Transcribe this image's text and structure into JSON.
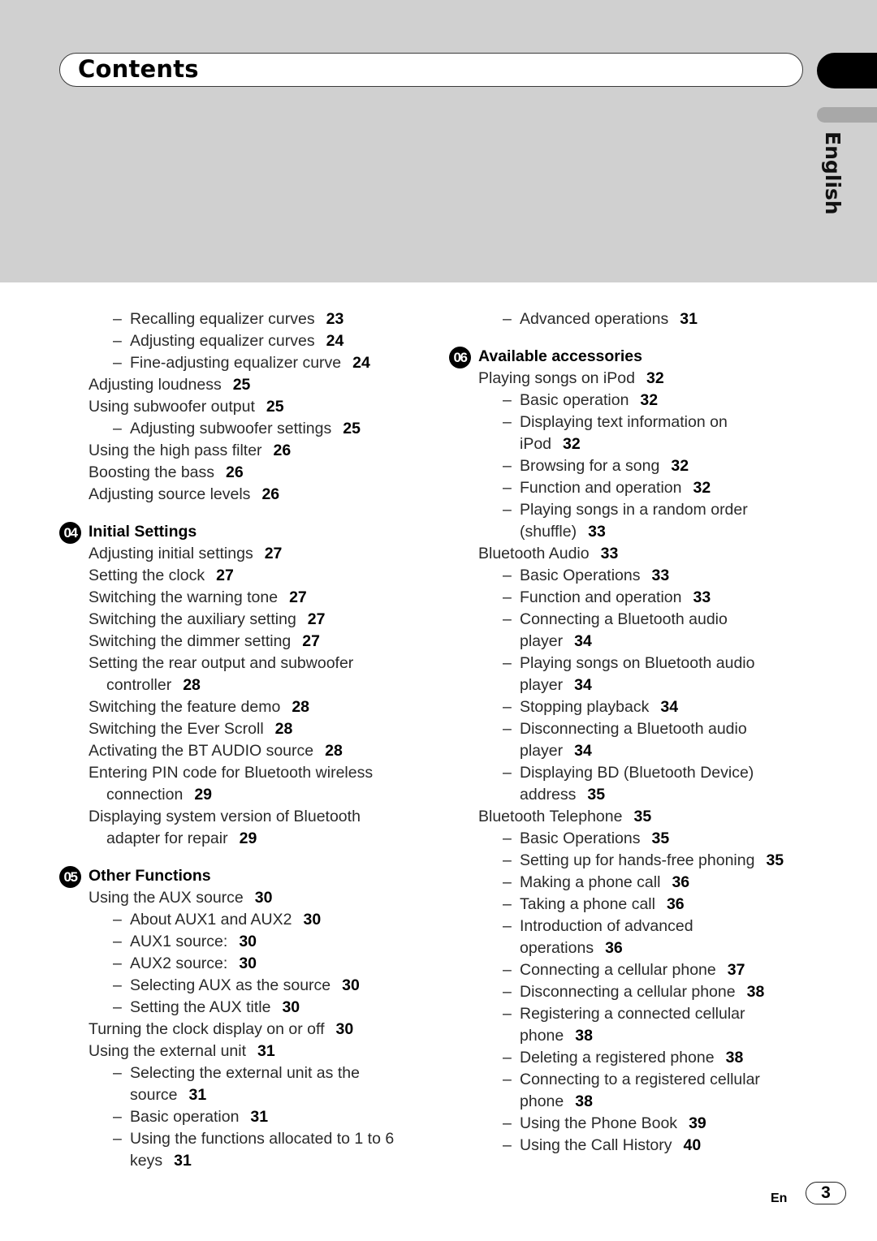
{
  "header": {
    "title": "Contents",
    "language_tab": "English"
  },
  "left_column": {
    "pre_entries": [
      {
        "level": 2,
        "text": "Recalling equalizer curves",
        "page": "23"
      },
      {
        "level": 2,
        "text": "Adjusting equalizer curves",
        "page": "24"
      },
      {
        "level": 2,
        "text": "Fine-adjusting equalizer curve",
        "page": "24"
      },
      {
        "level": 1,
        "text": "Adjusting loudness",
        "page": "25"
      },
      {
        "level": 1,
        "text": "Using subwoofer output",
        "page": "25"
      },
      {
        "level": 2,
        "text": "Adjusting subwoofer settings",
        "page": "25"
      },
      {
        "level": 1,
        "text": "Using the high pass filter",
        "page": "26"
      },
      {
        "level": 1,
        "text": "Boosting the bass",
        "page": "26"
      },
      {
        "level": 1,
        "text": "Adjusting source levels",
        "page": "26"
      }
    ],
    "sections": [
      {
        "number": "04",
        "title": "Initial Settings",
        "entries": [
          {
            "level": 1,
            "text": "Adjusting initial settings",
            "page": "27"
          },
          {
            "level": 1,
            "text": "Setting the clock",
            "page": "27"
          },
          {
            "level": 1,
            "text": "Switching the warning tone",
            "page": "27"
          },
          {
            "level": 1,
            "text": "Switching the auxiliary setting",
            "page": "27"
          },
          {
            "level": 1,
            "text": "Switching the dimmer setting",
            "page": "27"
          },
          {
            "level": 1,
            "text": "Setting the rear output and subwoofer",
            "cont": "controller",
            "page": "28"
          },
          {
            "level": 1,
            "text": "Switching the feature demo",
            "page": "28"
          },
          {
            "level": 1,
            "text": "Switching the Ever Scroll",
            "page": "28"
          },
          {
            "level": 1,
            "text": "Activating the BT AUDIO source",
            "page": "28"
          },
          {
            "level": 1,
            "text": "Entering PIN code for Bluetooth wireless",
            "cont": "connection",
            "page": "29"
          },
          {
            "level": 1,
            "text": "Displaying system version of Bluetooth",
            "cont": "adapter for repair",
            "page": "29"
          }
        ]
      },
      {
        "number": "05",
        "title": "Other Functions",
        "entries": [
          {
            "level": 1,
            "text": "Using the AUX source",
            "page": "30"
          },
          {
            "level": 2,
            "text": "About AUX1 and AUX2",
            "page": "30"
          },
          {
            "level": 2,
            "text": "AUX1 source:",
            "page": "30"
          },
          {
            "level": 2,
            "text": "AUX2 source:",
            "page": "30"
          },
          {
            "level": 2,
            "text": "Selecting AUX as the source",
            "page": "30"
          },
          {
            "level": 2,
            "text": "Setting the AUX title",
            "page": "30"
          },
          {
            "level": 1,
            "text": "Turning the clock display on or off",
            "page": "30"
          },
          {
            "level": 1,
            "text": "Using the external unit",
            "page": "31"
          },
          {
            "level": 2,
            "text": "Selecting the external unit as the",
            "cont": "source",
            "page": "31"
          },
          {
            "level": 2,
            "text": "Basic operation",
            "page": "31"
          },
          {
            "level": 2,
            "text": "Using the functions allocated to 1 to 6",
            "cont": "keys",
            "page": "31"
          }
        ]
      }
    ]
  },
  "right_column": {
    "pre_entries": [
      {
        "level": 2,
        "text": "Advanced operations",
        "page": "31"
      }
    ],
    "sections": [
      {
        "number": "06",
        "title": "Available accessories",
        "entries": [
          {
            "level": 1,
            "text": "Playing songs on iPod",
            "page": "32"
          },
          {
            "level": 2,
            "text": "Basic operation",
            "page": "32"
          },
          {
            "level": 2,
            "text": "Displaying text information on",
            "cont": "iPod",
            "page": "32"
          },
          {
            "level": 2,
            "text": "Browsing for a song",
            "page": "32"
          },
          {
            "level": 2,
            "text": "Function and operation",
            "page": "32"
          },
          {
            "level": 2,
            "text": "Playing songs in a random order",
            "cont": "(shuffle)",
            "page": "33"
          },
          {
            "level": 1,
            "text": "Bluetooth Audio",
            "page": "33"
          },
          {
            "level": 2,
            "text": "Basic Operations",
            "page": "33"
          },
          {
            "level": 2,
            "text": "Function and operation",
            "page": "33"
          },
          {
            "level": 2,
            "text": "Connecting a Bluetooth audio",
            "cont": "player",
            "page": "34"
          },
          {
            "level": 2,
            "text": "Playing songs on Bluetooth audio",
            "cont": "player",
            "page": "34"
          },
          {
            "level": 2,
            "text": "Stopping playback",
            "page": "34"
          },
          {
            "level": 2,
            "text": "Disconnecting a Bluetooth audio",
            "cont": "player",
            "page": "34"
          },
          {
            "level": 2,
            "text": "Displaying BD (Bluetooth Device)",
            "cont": "address",
            "page": "35"
          },
          {
            "level": 1,
            "text": "Bluetooth Telephone",
            "page": "35"
          },
          {
            "level": 2,
            "text": "Basic Operations",
            "page": "35"
          },
          {
            "level": 2,
            "text": "Setting up for hands-free phoning",
            "page": "35"
          },
          {
            "level": 2,
            "text": "Making a phone call",
            "page": "36"
          },
          {
            "level": 2,
            "text": "Taking a phone call",
            "page": "36"
          },
          {
            "level": 2,
            "text": "Introduction of advanced",
            "cont": "operations",
            "page": "36"
          },
          {
            "level": 2,
            "text": "Connecting a cellular phone",
            "page": "37"
          },
          {
            "level": 2,
            "text": "Disconnecting a cellular phone",
            "page": "38"
          },
          {
            "level": 2,
            "text": "Registering a connected cellular",
            "cont": "phone",
            "page": "38"
          },
          {
            "level": 2,
            "text": "Deleting a registered phone",
            "page": "38"
          },
          {
            "level": 2,
            "text": "Connecting to a registered cellular",
            "cont": "phone",
            "page": "38"
          },
          {
            "level": 2,
            "text": "Using the Phone Book",
            "page": "39"
          },
          {
            "level": 2,
            "text": "Using the Call History",
            "page": "40"
          }
        ]
      }
    ]
  },
  "footer": {
    "language_code": "En",
    "page_number": "3"
  }
}
